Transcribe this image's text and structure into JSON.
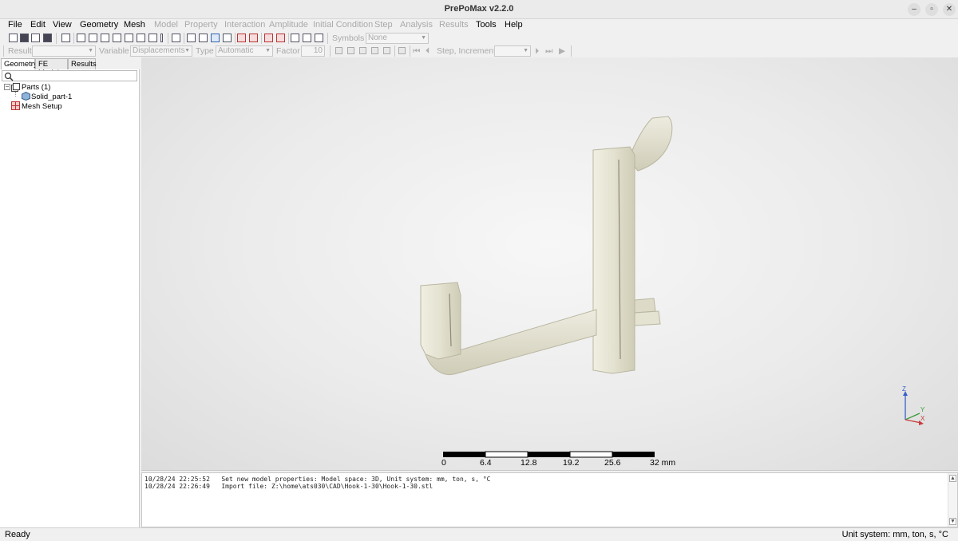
{
  "window": {
    "title": "PrePoMax v2.2.0"
  },
  "menu": {
    "items": [
      {
        "label": "File",
        "enabled": true
      },
      {
        "label": "Edit",
        "enabled": true
      },
      {
        "label": "View",
        "enabled": true
      },
      {
        "label": "Geometry",
        "enabled": true
      },
      {
        "label": "Mesh",
        "enabled": true
      },
      {
        "label": "Model",
        "enabled": false
      },
      {
        "label": "Property",
        "enabled": false
      },
      {
        "label": "Interaction",
        "enabled": false
      },
      {
        "label": "Amplitude",
        "enabled": false
      },
      {
        "label": "Initial Condition",
        "enabled": false
      },
      {
        "label": "Step",
        "enabled": false
      },
      {
        "label": "Analysis",
        "enabled": false
      },
      {
        "label": "Results",
        "enabled": false
      },
      {
        "label": "Tools",
        "enabled": true
      },
      {
        "label": "Help",
        "enabled": true
      }
    ]
  },
  "toolbar1": {
    "symbols_label": "Symbols",
    "symbols_value": "None"
  },
  "toolbar2": {
    "result_label": "Result",
    "result_value": "",
    "variable_label": "Variable",
    "variable_value": "Displacements",
    "type_label": "Type",
    "type_value": "Automatic",
    "factor_label": "Factor",
    "factor_value": "10",
    "step_increment_label": "Step, Increment",
    "step_increment_value": ""
  },
  "left_panel": {
    "tabs": [
      "Geometry",
      "FE Model",
      "Results"
    ],
    "active_tab": "Geometry",
    "search_placeholder": "",
    "tree": {
      "parts_label": "Parts (1)",
      "part_name": "Solid_part-1",
      "mesh_setup_label": "Mesh Setup"
    }
  },
  "viewport": {
    "scale_bar": {
      "ticks": [
        "0",
        "6.4",
        "12.8",
        "19.2",
        "25.6",
        "32 mm"
      ]
    },
    "triad": {
      "z": "Z",
      "y": "Y",
      "x": "X"
    },
    "model_color": "#e6e4d2"
  },
  "console": {
    "lines": [
      "10/28/24 22:25:52   Set new model properties: Model space: 3D, Unit system: mm, ton, s, °C",
      "10/28/24 22:26:49   Import file: Z:\\home\\ats030\\CAD\\Hook-1-30\\Hook-1-30.stl"
    ]
  },
  "status": {
    "left": "Ready",
    "right": "Unit system: mm, ton, s, °C"
  }
}
